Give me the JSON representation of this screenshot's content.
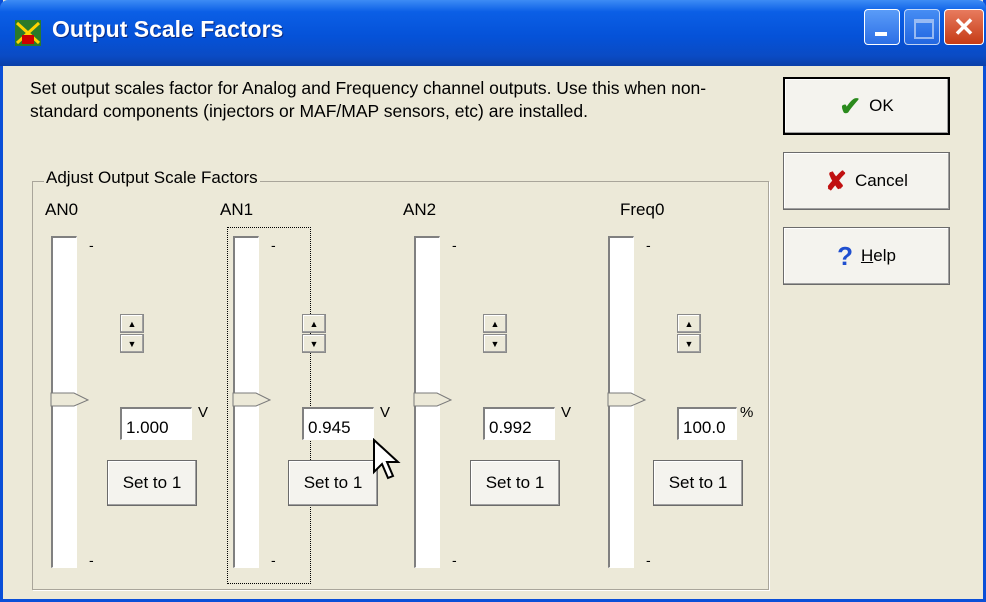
{
  "window": {
    "title": "Output Scale Factors"
  },
  "description": "Set output scales factor for Analog and Frequency channel outputs.  Use this when non-standard components (injectors or MAF/MAP sensors, etc) are installed.",
  "buttons": {
    "ok": "OK",
    "cancel": "Cancel",
    "help_prefix": "H",
    "help_rest": "elp"
  },
  "group": {
    "label": "Adjust Output Scale Factors"
  },
  "channels": [
    {
      "name": "AN0",
      "value": "1.000",
      "unit": "V",
      "reset_label": "Set to 1",
      "tick_top": "-",
      "tick_bottom": "-"
    },
    {
      "name": "AN1",
      "value": "0.945",
      "unit": "V",
      "reset_label": "Set to 1",
      "tick_top": "-",
      "tick_bottom": "-"
    },
    {
      "name": "AN2",
      "value": "0.992",
      "unit": "V",
      "reset_label": "Set to 1",
      "tick_top": "-",
      "tick_bottom": "-"
    },
    {
      "name": "Freq0",
      "value": "100.0",
      "unit": "%",
      "reset_label": "Set to 1",
      "tick_top": "-",
      "tick_bottom": "-"
    }
  ],
  "colors": {
    "title_bar": "#0552d8",
    "dialog_bg": "#ece9d8",
    "ok_icon": "#2a8a1c",
    "cancel_icon": "#c01010",
    "help_icon": "#1f4fd0"
  },
  "icons": {
    "app": "app-icon",
    "ok": "check-icon",
    "cancel": "x-icon",
    "help": "question-icon"
  }
}
